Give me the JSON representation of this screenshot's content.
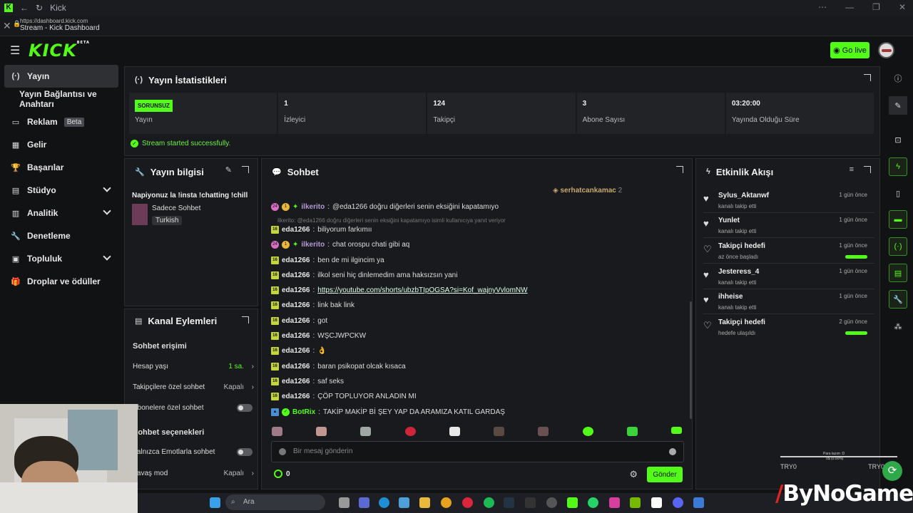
{
  "browser": {
    "tab_title": "Kick",
    "url": "https://dashboard.kick.com",
    "page_title": "Stream - Kick Dashboard"
  },
  "header": {
    "logo": "KICK",
    "logo_tag": "BETA",
    "go_live": "Go live"
  },
  "sidebar": {
    "items": [
      {
        "label": "Yayın",
        "icon": "broadcast-icon"
      },
      {
        "label": "Yayın Bağlantısı ve Anahtarı"
      },
      {
        "label": "Reklam",
        "badge": "Beta",
        "icon": "ad-icon"
      },
      {
        "label": "Gelir",
        "icon": "revenue-icon"
      },
      {
        "label": "Başarılar",
        "icon": "trophy-icon"
      },
      {
        "label": "Stüdyo",
        "icon": "studio-icon"
      },
      {
        "label": "Analitik",
        "icon": "analytics-icon"
      },
      {
        "label": "Denetleme",
        "icon": "wrench-icon"
      },
      {
        "label": "Topluluk",
        "icon": "community-icon"
      },
      {
        "label": "Droplar ve ödüller",
        "icon": "gift-icon"
      }
    ]
  },
  "stats": {
    "title": "Yayın İstatistikleri",
    "status_badge": "SORUNSUZ",
    "status_label": "Yayın",
    "viewers": "1",
    "viewers_label": "İzleyici",
    "followers": "124",
    "followers_label": "Takipçi",
    "subs": "3",
    "subs_label": "Abone Sayısı",
    "uptime": "03:20:00",
    "uptime_label": "Yayında Olduğu Süre",
    "success": "Stream started successfully."
  },
  "info": {
    "title": "Yayın bilgisi",
    "stream_title": "Napiyonuz la !insta !chatting !chill",
    "category": "Sadece Sohbet",
    "language": "Turkish"
  },
  "actions": {
    "title": "Kanal Eylemleri",
    "chat_access": "Sohbet erişimi",
    "account_age": "Hesap yaşı",
    "account_age_value": "1 sa.",
    "followers_only": "Takipçilere özel sohbet",
    "followers_only_value": "Kapalı",
    "subs_only": "Abonelere özel sohbet",
    "chat_options": "Sohbet seçenekleri",
    "emote_only": "Yalnızca Emotlarla sohbet",
    "slow_mode": "Yavaş mod",
    "slow_mode_value": "Kapalı"
  },
  "chat": {
    "title": "Sohbet",
    "pinned_user": "serhatcankamac",
    "pinned_count": "2",
    "messages": [
      {
        "badge": "",
        "user": "ilkerito",
        "text": "@eda1266 doğru diğerleri senin eksiğini kapatamıyo"
      },
      {
        "reply": "ilkerito: @eda1266 doğru diğerleri senin eksiğini kapatamıyo isimli kullanıcıya yanıt veriyor",
        "user": "eda1266",
        "text": "biliyorum farkımıı"
      },
      {
        "user": "ilkerito",
        "text": "chat orospu chati gibi aq"
      },
      {
        "user": "eda1266",
        "text": "ben de mi ilgincim ya"
      },
      {
        "user": "eda1266",
        "text": "ilkol seni hiç dinlemedim ama haksızsın yani"
      },
      {
        "user": "eda1266",
        "text": "https://youtube.com/shorts/ubzbTIpOGSA?si=Kof_wajnyVvlomNW"
      },
      {
        "user": "eda1266",
        "text": "link bak link"
      },
      {
        "user": "eda1266",
        "text": "got"
      },
      {
        "user": "eda1266",
        "text": "WŞCJWPCKW"
      },
      {
        "user": "eda1266",
        "text": "👌"
      },
      {
        "user": "eda1266",
        "text": "baran psikopat olcak kısaca"
      },
      {
        "user": "eda1266",
        "text": "saf seks"
      },
      {
        "user": "eda1266",
        "text": "ÇÖP TOPLUYOR ANLADIN MI"
      },
      {
        "user": "BotRix",
        "text": "TAKİP MAKİP Bİ ŞEY YAP DA ARAMIZA KATIL GARDAŞ"
      }
    ],
    "placeholder": "Bir mesaj gönderin",
    "points": "0",
    "send": "Gönder"
  },
  "activity": {
    "title": "Etkinlik Akışı",
    "events": [
      {
        "name": "Sylus_Aktanwf",
        "sub": "kanalı takip etti",
        "time": "1 gün önce"
      },
      {
        "name": "Yunlet",
        "sub": "kanalı takip etti",
        "time": "1 gün önce"
      },
      {
        "name": "Takipçi hedefi",
        "sub": "az önce başladı",
        "time": "1 gün önce",
        "progress": 1
      },
      {
        "name": "Jesteress_4",
        "sub": "kanalı takip etti",
        "time": "1 gün önce"
      },
      {
        "name": "ihheise",
        "sub": "kanalı takip etti",
        "time": "1 gün önce"
      },
      {
        "name": "Takipçi hedefi",
        "sub": "hedefe ulaşıldı",
        "time": "2 gün önce",
        "progress": 1
      }
    ]
  },
  "taskbar": {
    "search": "Ara"
  },
  "overlay": {
    "brand": "ByNoGame",
    "try_left": "TRY0",
    "try_right": "TRY0",
    "mini_text": "Para lazım :D",
    "mini_value": "0$ (0.00%)"
  },
  "colors": {
    "accent": "#53fc18",
    "background": "#111214",
    "panel": "#191a1d"
  }
}
